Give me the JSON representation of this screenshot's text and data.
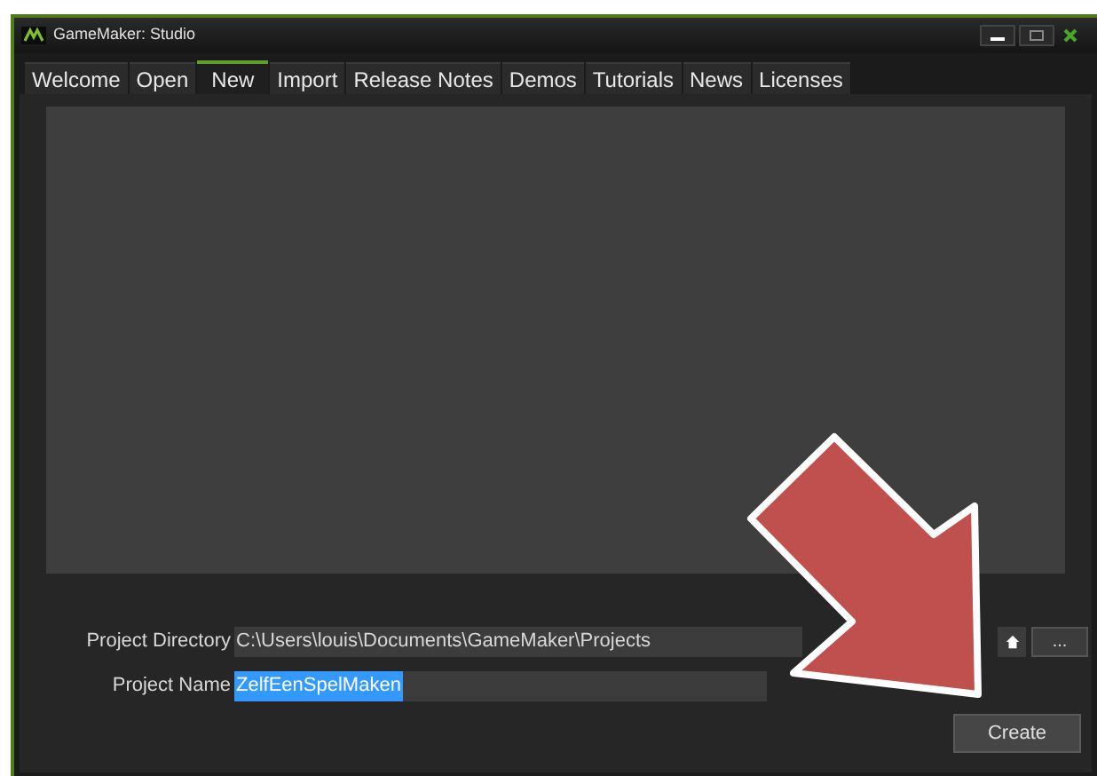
{
  "window": {
    "title": "GameMaker: Studio"
  },
  "tabs": [
    {
      "label": "Welcome",
      "selected": false
    },
    {
      "label": "Open",
      "selected": false
    },
    {
      "label": "New",
      "selected": true
    },
    {
      "label": "Import",
      "selected": false
    },
    {
      "label": "Release Notes",
      "selected": false
    },
    {
      "label": "Demos",
      "selected": false
    },
    {
      "label": "Tutorials",
      "selected": false
    },
    {
      "label": "News",
      "selected": false
    },
    {
      "label": "Licenses",
      "selected": false
    }
  ],
  "project_directory": {
    "label": "Project Directory",
    "value": "C:\\Users\\louis\\Documents\\GameMaker\\Projects",
    "browse_button": "..."
  },
  "project_name": {
    "label": "Project Name",
    "value": "ZelfEenSpelMaken"
  },
  "create_button": "Create"
}
